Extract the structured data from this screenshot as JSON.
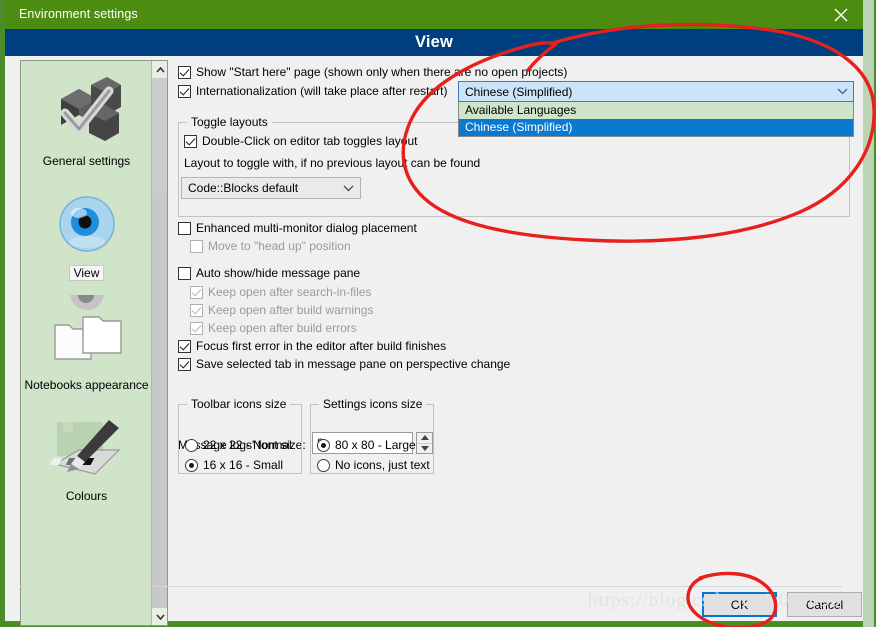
{
  "window": {
    "title": "Environment settings",
    "close_icon": "close-icon",
    "header_title": "View",
    "title_bar_color": "#4c8c10",
    "header_color": "#003f7f",
    "border_color": "#4a8c2a"
  },
  "sidebar": {
    "background_color": "#cfe4c8",
    "items": [
      {
        "label": "General settings",
        "icon": "boxes-check-icon",
        "selected": false
      },
      {
        "label": "View",
        "icon": "eye-icon",
        "selected": true
      },
      {
        "label": "Notebooks appearance",
        "icon": "folders-icon",
        "selected": false
      },
      {
        "label": "Colours",
        "icon": "paint-palette-icon",
        "selected": false
      }
    ],
    "scrollbar": {
      "up_arrow": "chevron-up-icon",
      "down_arrow": "chevron-down-icon"
    }
  },
  "content": {
    "show_start_here": {
      "label": "Show \"Start here\" page (shown only when there are no open projects)",
      "checked": true,
      "enabled": true
    },
    "internationalization": {
      "label": "Internationalization (will take place after restart)",
      "checked": true,
      "enabled": true
    },
    "language_combo": {
      "value": "Chinese (Simplified)",
      "expanded": true,
      "arrow_icon": "chevron-down-icon",
      "options": [
        {
          "label": "Available Languages",
          "is_header": true,
          "selected": false
        },
        {
          "label": "Chinese (Simplified)",
          "is_header": false,
          "selected": true
        }
      ]
    },
    "toggle_layouts": {
      "title": "Toggle layouts",
      "double_click": {
        "label": "Double-Click on editor tab toggles layout",
        "checked": true,
        "enabled": true
      },
      "hint": "Layout to toggle with, if no previous layout can be found",
      "layout_select": {
        "value": "Code::Blocks default",
        "arrow_icon": "chevron-down-icon"
      }
    },
    "enhanced_multimonitor": {
      "label": "Enhanced multi-monitor dialog placement",
      "checked": false,
      "enabled": true
    },
    "move_head_up": {
      "label": "Move to \"head up\" position",
      "checked": false,
      "enabled": false
    },
    "auto_show_hide": {
      "label": "Auto show/hide message pane",
      "checked": false,
      "enabled": true
    },
    "keep_open_search": {
      "label": "Keep open after search-in-files",
      "checked": true,
      "enabled": false
    },
    "keep_open_warnings": {
      "label": "Keep open after build warnings",
      "checked": true,
      "enabled": false
    },
    "keep_open_errors": {
      "label": "Keep open after build errors",
      "checked": true,
      "enabled": false
    },
    "focus_first_error": {
      "label": "Focus first error in the editor after build finishes",
      "checked": true,
      "enabled": true
    },
    "save_selected_tab": {
      "label": "Save selected tab in message pane on perspective change",
      "checked": true,
      "enabled": true
    },
    "message_font_size": {
      "label": "Message logs' font size:",
      "value": "8",
      "spin_up_icon": "triangle-up-icon",
      "spin_down_icon": "triangle-down-icon"
    },
    "toolbar_icons_size": {
      "title": "Toolbar icons size",
      "options": [
        {
          "label": "22 x 22 - Normal",
          "selected": false
        },
        {
          "label": "16 x 16 - Small",
          "selected": true
        }
      ]
    },
    "settings_icons_size": {
      "title": "Settings icons size",
      "options": [
        {
          "label": "80 x 80 - Large",
          "selected": true
        },
        {
          "label": "No icons, just text",
          "selected": false
        }
      ]
    }
  },
  "footer": {
    "ok_label": "OK",
    "cancel_label": "Cancel",
    "ok_focus_color": "#0078d7"
  },
  "watermark": {
    "text": "https://blog.csdn.net/c0c0056",
    "color": "#e2e2e2"
  },
  "annotations": {
    "color": "#e8201c",
    "shapes": [
      "ellipse-around-language-dropdown",
      "ellipse-around-ok-button"
    ]
  }
}
